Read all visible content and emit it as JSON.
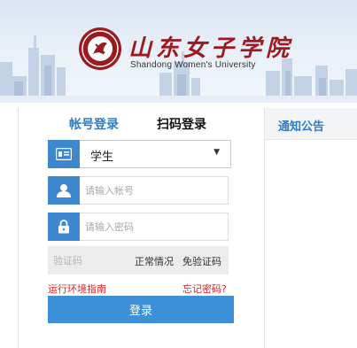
{
  "header": {
    "school_name_cn": "山东女子学院",
    "school_name_en": "Shandong Women's University"
  },
  "login": {
    "tabs": [
      {
        "label": "帐号登录",
        "active": true
      },
      {
        "label": "扫码登录",
        "active": false
      }
    ],
    "role_select": {
      "value": "学生"
    },
    "account_input": {
      "placeholder": "请输入帐号",
      "value": ""
    },
    "password_input": {
      "placeholder": "请输入密码",
      "value": ""
    },
    "captcha": {
      "placeholder": "验证码",
      "status": "正常情况",
      "mode": "免验证码"
    },
    "env_guide_link": "运行环境指南",
    "forgot_password_link": "忘记密码?",
    "submit_label": "登录"
  },
  "notice": {
    "title": "通知公告"
  },
  "colors": {
    "primary": "#3c87cd",
    "button": "#3c90d8",
    "accent_red": "#d9252a",
    "logo_red": "#9c1a1e"
  },
  "icons": {
    "role": "id-card-icon",
    "account": "user-icon",
    "password": "lock-icon"
  }
}
